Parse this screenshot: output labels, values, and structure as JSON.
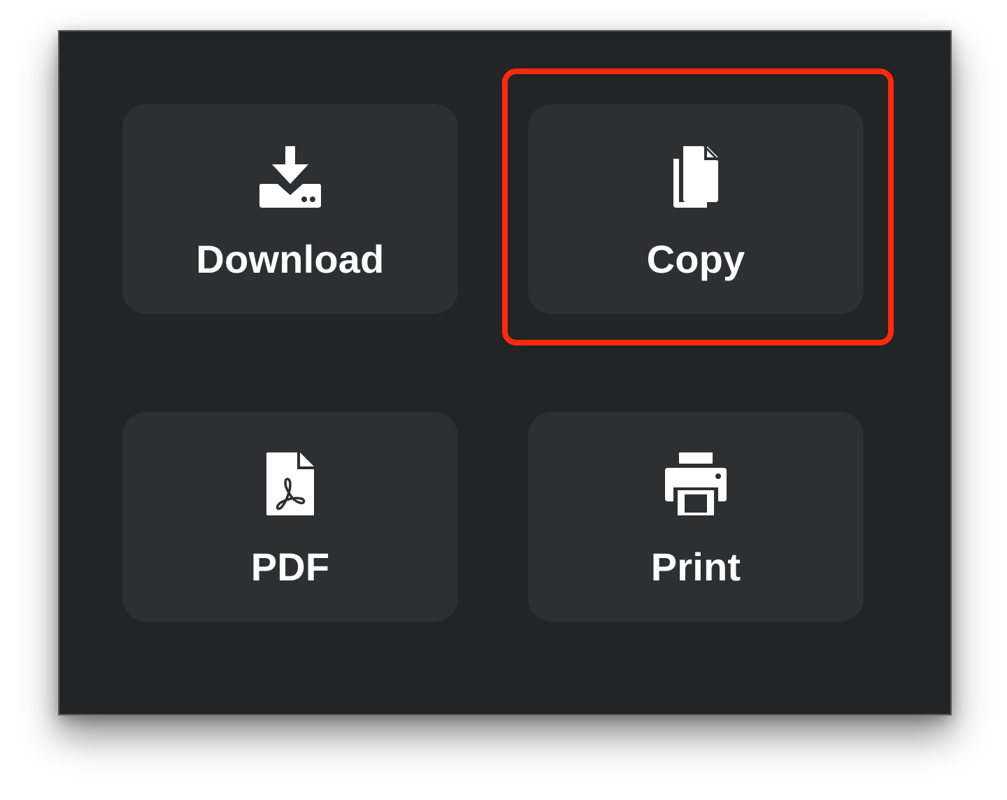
{
  "share_menu": {
    "items": [
      {
        "id": "download",
        "label": "Download",
        "icon": "download-tray-icon"
      },
      {
        "id": "copy",
        "label": "Copy",
        "icon": "copy-documents-icon"
      },
      {
        "id": "pdf",
        "label": "PDF",
        "icon": "pdf-file-icon"
      },
      {
        "id": "print",
        "label": "Print",
        "icon": "printer-icon"
      }
    ],
    "highlighted_item": "copy"
  },
  "colors": {
    "panel_background": "#232426",
    "tile_background": "#2e2f31",
    "label_text": "#ffffff",
    "highlight_border": "#ff2a0e"
  }
}
